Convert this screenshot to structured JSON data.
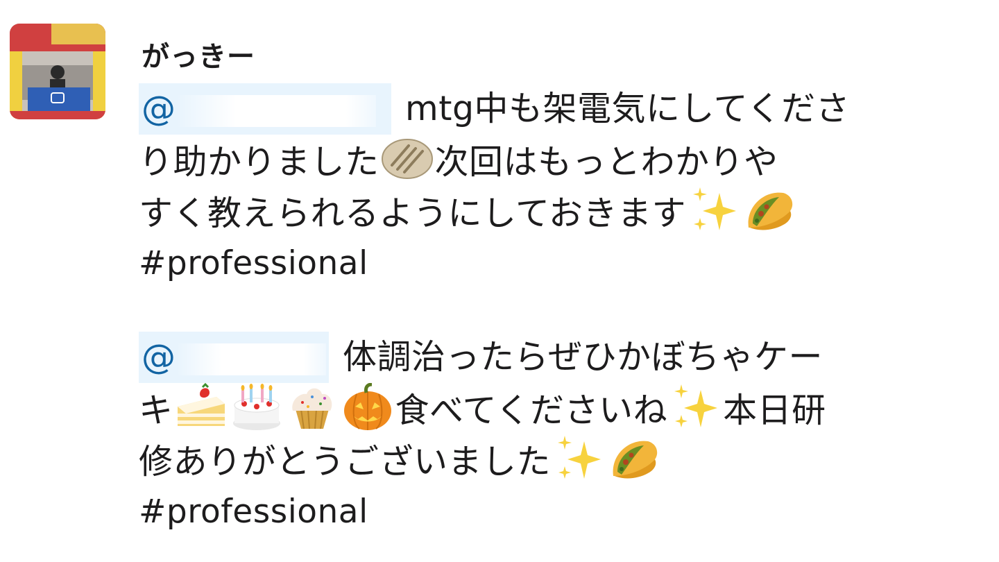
{
  "message": {
    "author": "がっきー",
    "avatar_icon": "user-photo-avatar",
    "posts": [
      {
        "mention": "@",
        "lines": [
          [
            "mtg中も架電気にしてくださ"
          ],
          [
            "り助かりました",
            "次回はもっとわかりや"
          ],
          [
            "すく教えられるようにしておきます"
          ]
        ],
        "hashtag": "#professional",
        "emojis": [
          "rice-cracker-emoji",
          "sparkles-emoji",
          "taco-emoji"
        ]
      },
      {
        "mention": "@",
        "lines": [
          [
            "体調治ったらぜひかぼちゃケー"
          ],
          [
            "キ",
            "食べてくださいね",
            "本日研"
          ],
          [
            "修ありがとうございました"
          ]
        ],
        "hashtag": "#professional",
        "emojis": [
          "shortcake-emoji",
          "birthday-cake-emoji",
          "cupcake-emoji",
          "jack-o-lantern-emoji",
          "sparkles-emoji",
          "sparkles-emoji",
          "taco-emoji"
        ]
      }
    ]
  },
  "colors": {
    "mention_bg": "#e8f4fd",
    "mention_text": "#1264a3",
    "text": "#1d1c1d"
  }
}
